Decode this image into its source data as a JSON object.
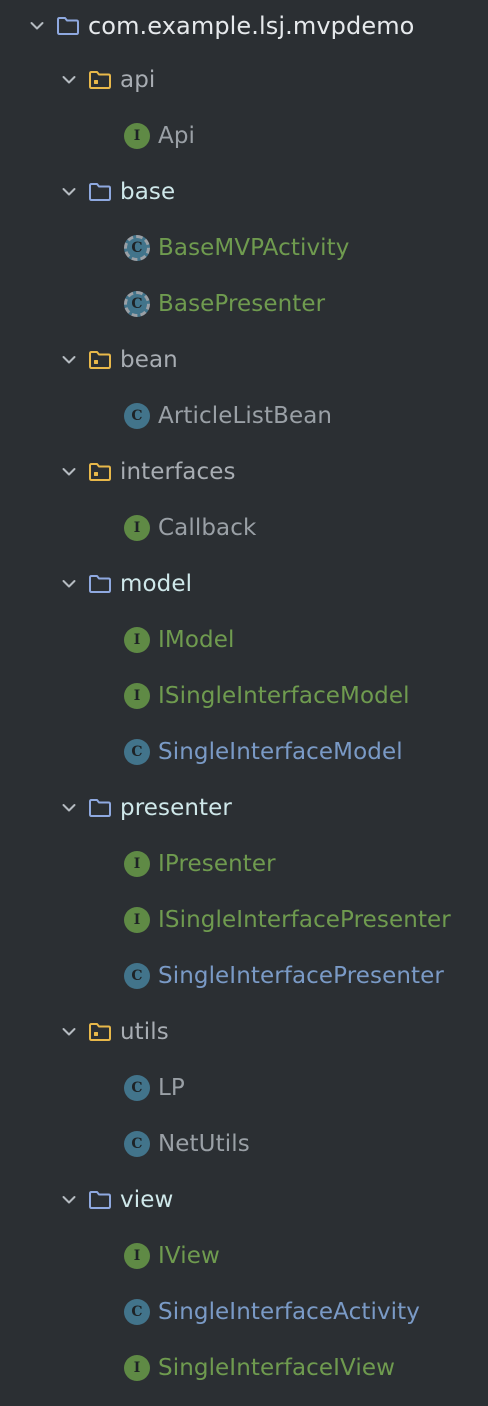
{
  "colors": {
    "background": "#2b2f33",
    "folder_package": "#e8b84a",
    "folder_blue": "#8fa9e0",
    "interface_badge": "#5f8a45",
    "class_badge": "#42748b",
    "text_green": "#6f9b4f",
    "text_blue": "#7a9ac6",
    "text_plain": "#9aa0a6"
  },
  "tree": [
    {
      "label": "com.example.lsj.mvpdemo",
      "kind": "root",
      "icon": "folder-icon",
      "expanded": true
    },
    {
      "label": "api",
      "kind": "package",
      "icon": "package-folder-icon",
      "expanded": true
    },
    {
      "label": "Api",
      "kind": "interface",
      "icon": "interface-icon",
      "badge": "I",
      "status": "plain"
    },
    {
      "label": "base",
      "kind": "folder",
      "icon": "folder-icon",
      "expanded": true
    },
    {
      "label": "BaseMVPActivity",
      "kind": "abstract",
      "icon": "abstract-class-icon",
      "badge": "C",
      "status": "green"
    },
    {
      "label": "BasePresenter",
      "kind": "abstract",
      "icon": "abstract-class-icon",
      "badge": "C",
      "status": "green"
    },
    {
      "label": "bean",
      "kind": "package",
      "icon": "package-folder-icon",
      "expanded": true
    },
    {
      "label": "ArticleListBean",
      "kind": "class",
      "icon": "class-icon",
      "badge": "C",
      "status": "plain"
    },
    {
      "label": "interfaces",
      "kind": "package",
      "icon": "package-folder-icon",
      "expanded": true
    },
    {
      "label": "Callback",
      "kind": "interface",
      "icon": "interface-icon",
      "badge": "I",
      "status": "plain"
    },
    {
      "label": "model",
      "kind": "folder",
      "icon": "folder-icon",
      "expanded": true
    },
    {
      "label": "IModel",
      "kind": "interface",
      "icon": "interface-icon",
      "badge": "I",
      "status": "green"
    },
    {
      "label": "ISingleInterfaceModel",
      "kind": "interface",
      "icon": "interface-icon",
      "badge": "I",
      "status": "green"
    },
    {
      "label": "SingleInterfaceModel",
      "kind": "class",
      "icon": "class-icon",
      "badge": "C",
      "status": "blue"
    },
    {
      "label": "presenter",
      "kind": "folder",
      "icon": "folder-icon",
      "expanded": true
    },
    {
      "label": "IPresenter",
      "kind": "interface",
      "icon": "interface-icon",
      "badge": "I",
      "status": "green"
    },
    {
      "label": "ISingleInterfacePresenter",
      "kind": "interface",
      "icon": "interface-icon",
      "badge": "I",
      "status": "green"
    },
    {
      "label": "SingleInterfacePresenter",
      "kind": "class",
      "icon": "class-icon",
      "badge": "C",
      "status": "blue"
    },
    {
      "label": "utils",
      "kind": "package",
      "icon": "package-folder-icon",
      "expanded": true
    },
    {
      "label": "LP",
      "kind": "class",
      "icon": "class-icon",
      "badge": "C",
      "status": "plain"
    },
    {
      "label": "NetUtils",
      "kind": "class",
      "icon": "class-icon",
      "badge": "C",
      "status": "plain"
    },
    {
      "label": "view",
      "kind": "folder",
      "icon": "folder-icon",
      "expanded": true
    },
    {
      "label": "IView",
      "kind": "interface",
      "icon": "interface-icon",
      "badge": "I",
      "status": "green"
    },
    {
      "label": "SingleInterfaceActivity",
      "kind": "class",
      "icon": "class-icon",
      "badge": "C",
      "status": "blue"
    },
    {
      "label": "SingleInterfaceIView",
      "kind": "interface",
      "icon": "interface-icon",
      "badge": "I",
      "status": "green"
    }
  ]
}
